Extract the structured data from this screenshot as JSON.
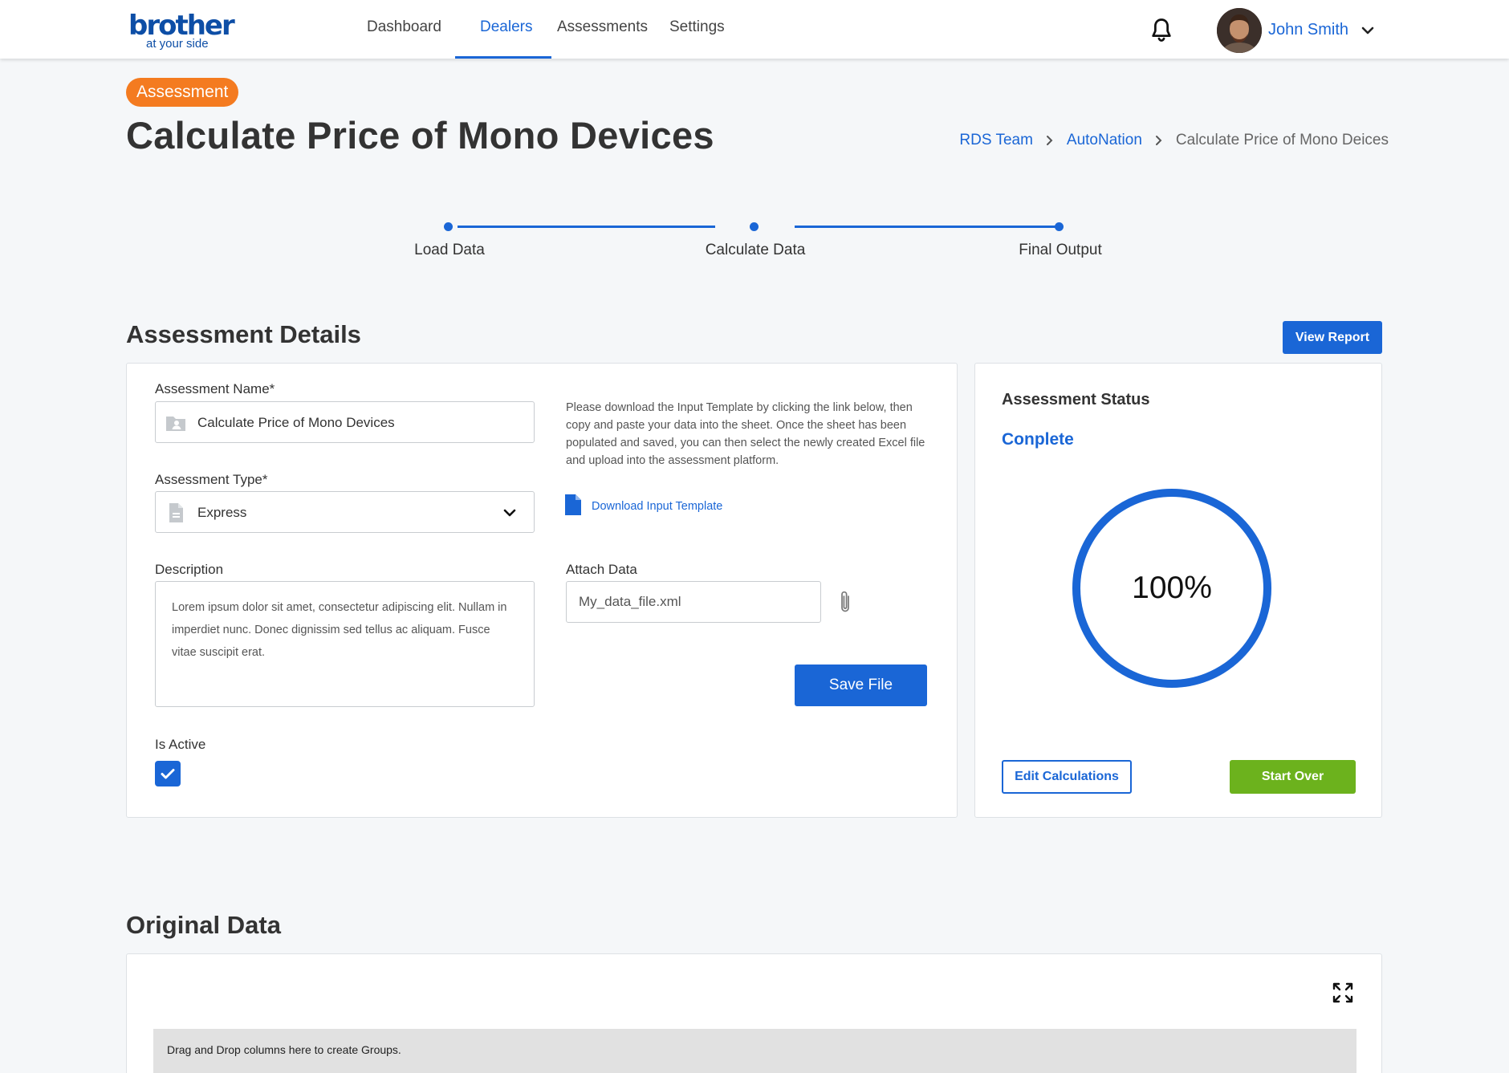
{
  "colors": {
    "primary": "#1a66d6",
    "badge": "#f47b20",
    "success": "#6cb21d"
  },
  "header": {
    "logo_brand": "brother",
    "logo_tagline": "at your side",
    "nav": [
      "Dashboard",
      "Dealers",
      "Assessments",
      "Settings"
    ],
    "active_nav": "Dealers",
    "notification_icon": "bell-icon",
    "user_name": "John Smith"
  },
  "page": {
    "badge": "Assessment",
    "title": "Calculate Price of Mono Devices",
    "breadcrumb": [
      "RDS Team",
      "AutoNation",
      "Calculate Price of Mono Deices"
    ]
  },
  "stepper": {
    "steps": [
      "Load Data",
      "Calculate Data",
      "Final Output"
    ]
  },
  "details": {
    "section_title": "Assessment Details",
    "view_report": "View Report",
    "name_label": "Assessment Name*",
    "name_value": "Calculate Price of Mono Devices",
    "type_label": "Assessment Type*",
    "type_value": "Express",
    "description_label": "Description",
    "description_value": "Lorem ipsum dolor sit amet, consectetur adipiscing elit. Nullam in imperdiet nunc. Donec dignissim sed tellus ac aliquam. Fusce vitae suscipit erat.",
    "help_text": "Please download the Input Template by clicking the link below, then copy and paste your data into the sheet. Once the sheet has been populated and saved, you can then select the newly created Excel file and upload into the assessment platform.",
    "download_link": "Download Input Template",
    "attach_label": "Attach Data",
    "attach_value": "My_data_file.xml",
    "save_file": "Save File",
    "active_label": "Is Active",
    "is_active": true
  },
  "status": {
    "heading": "Assessment Status",
    "value": "Conplete",
    "progress_percent": 100,
    "progress_text": "100%",
    "edit_button": "Edit Calculations",
    "start_over_button": "Start Over"
  },
  "original_data": {
    "section_title": "Original Data",
    "group_hint": "Drag and Drop columns here to create Groups."
  }
}
